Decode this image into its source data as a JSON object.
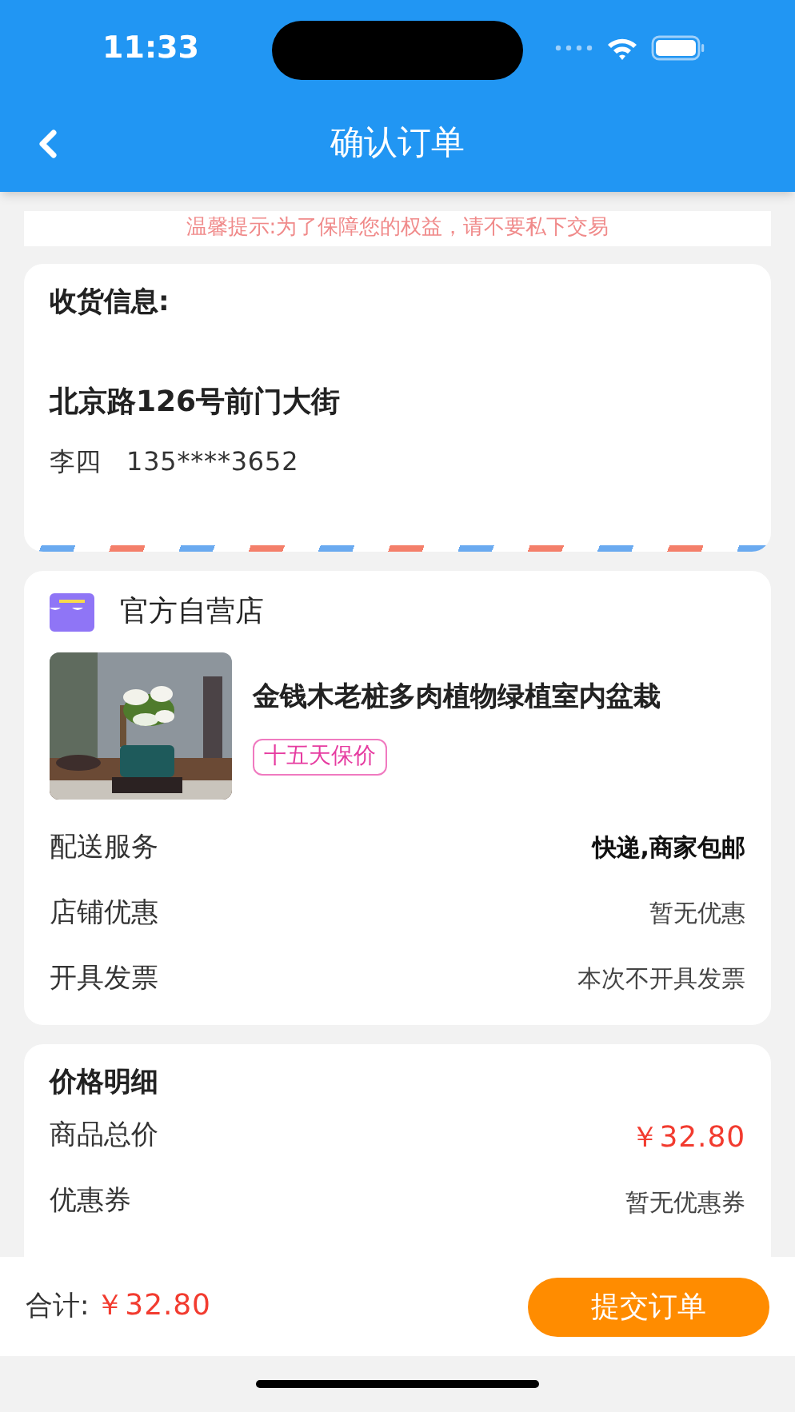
{
  "status_bar": {
    "time": "11:33"
  },
  "nav": {
    "title": "确认订单"
  },
  "notice": "温馨提示:为了保障您的权益，请不要私下交易",
  "address": {
    "heading": "收货信息:",
    "street": "北京路126号前门大街",
    "name": "李四",
    "phone": "135****3652"
  },
  "store": {
    "name": "官方自营店",
    "product": {
      "kind": "picture",
      "title": "金钱木老桩多肉植物绿植室内盆栽",
      "tag": "十五天保价"
    },
    "rows": [
      {
        "label": "配送服务",
        "value": "快递,商家包邮",
        "emphasis": true
      },
      {
        "label": "店铺优惠",
        "value": "暂无优惠",
        "emphasis": false
      },
      {
        "label": "开具发票",
        "value": "本次不开具发票",
        "emphasis": false
      }
    ]
  },
  "price": {
    "heading": "价格明细",
    "rows": [
      {
        "label": "商品总价",
        "value": "￥32.80",
        "highlight": true
      },
      {
        "label": "优惠券",
        "value": "暂无优惠券",
        "highlight": false
      }
    ]
  },
  "footer": {
    "total_label": "合计:",
    "total": "￥32.80",
    "submit": "提交订单"
  }
}
